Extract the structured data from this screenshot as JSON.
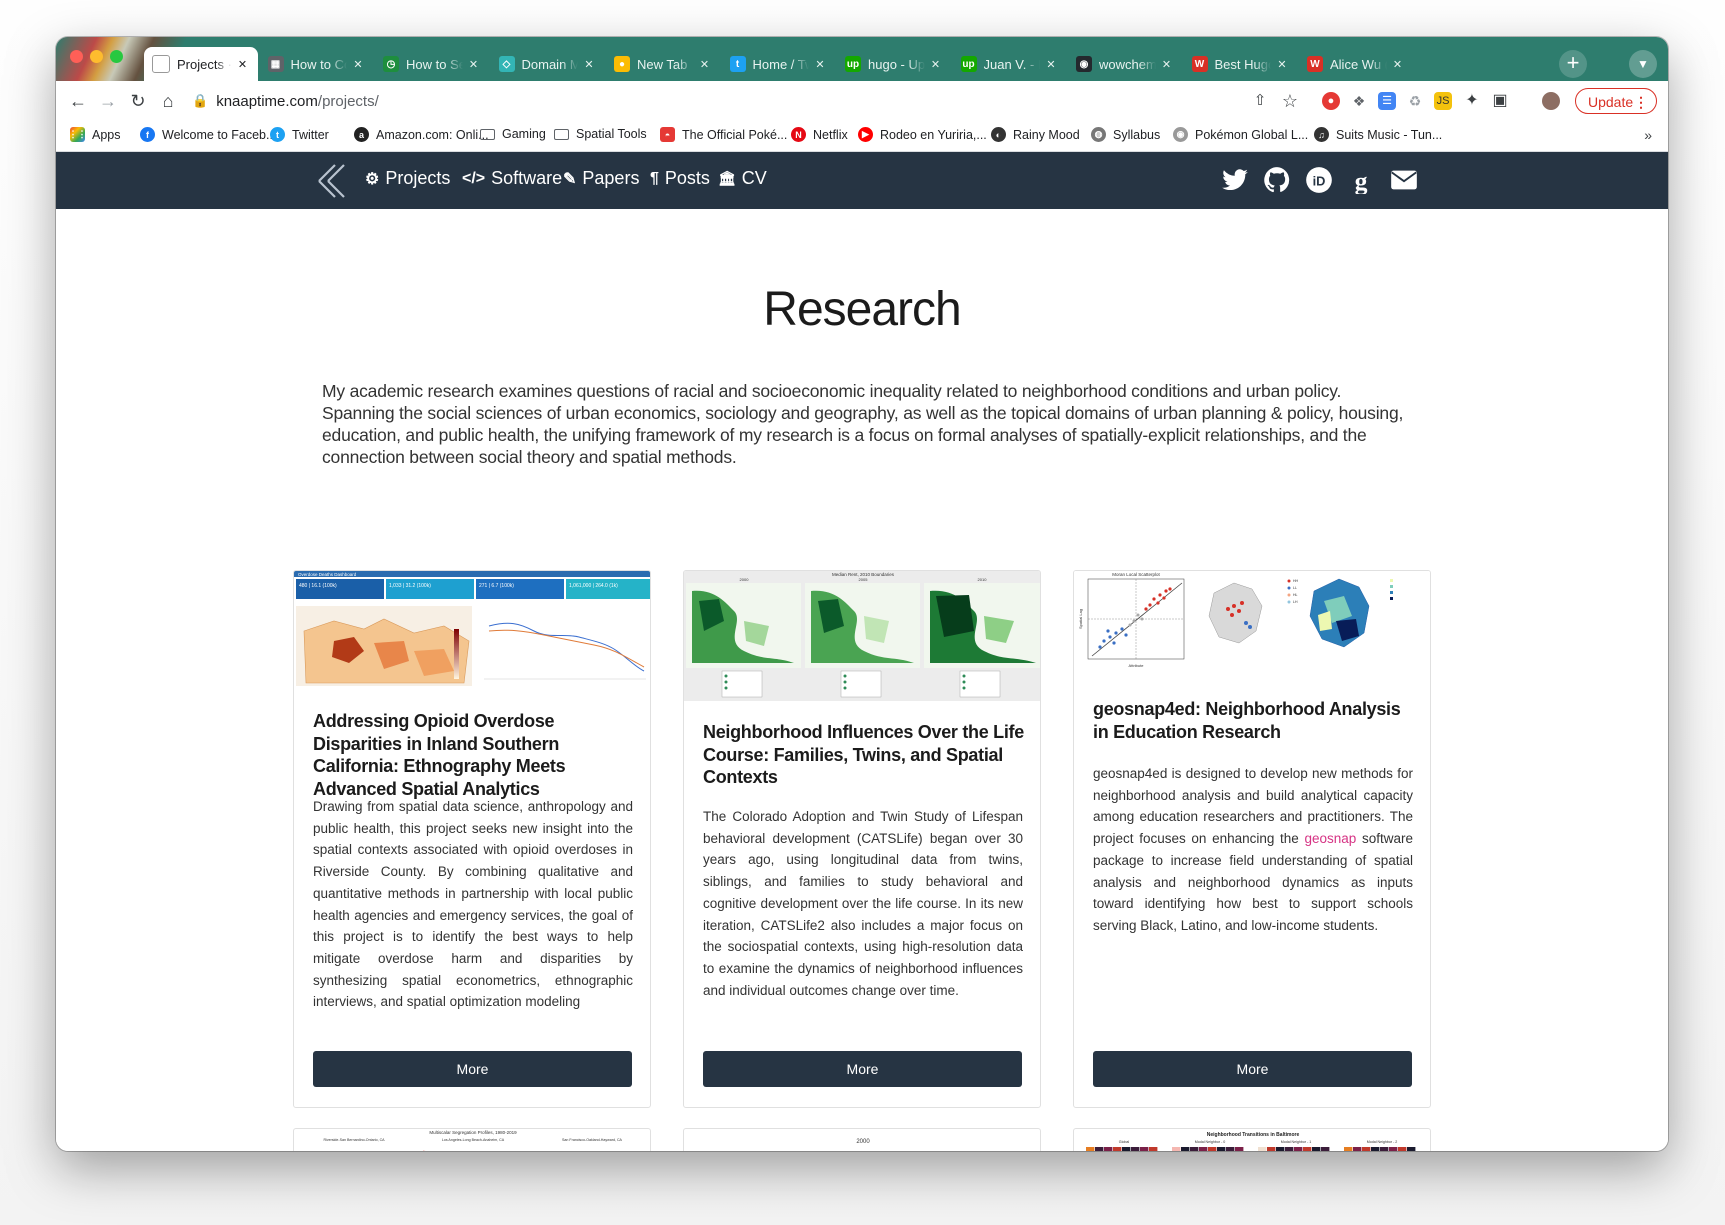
{
  "browser": {
    "tabs": [
      {
        "title": "Projects · k",
        "favicon": "page-icon",
        "active": true
      },
      {
        "title": "How to Cor",
        "favicon": "calendar-icon"
      },
      {
        "title": "How to Set",
        "favicon": "clock-icon"
      },
      {
        "title": "Domain Ma",
        "favicon": "netlify-icon"
      },
      {
        "title": "New Tab",
        "favicon": "chrome-icon"
      },
      {
        "title": "Home / Twi",
        "favicon": "twitter-icon"
      },
      {
        "title": "hugo - Upv",
        "favicon": "upwork-icon"
      },
      {
        "title": "Juan V. - F",
        "favicon": "upwork-icon"
      },
      {
        "title": "wowchemy",
        "favicon": "github-icon"
      },
      {
        "title": "Best Hugo",
        "favicon": "w-icon"
      },
      {
        "title": "Alice Wu (l",
        "favicon": "w-icon"
      }
    ],
    "new_tab": "+",
    "url_host": "knaaptime.com",
    "url_path": "/projects/",
    "update_label": "Update",
    "bookmarks": [
      {
        "label": "Apps",
        "icon": "apps-icon"
      },
      {
        "label": "Welcome to Faceb...",
        "icon": "facebook-icon"
      },
      {
        "label": "Twitter",
        "icon": "twitter-icon"
      },
      {
        "label": "Amazon.com: Onli...",
        "icon": "amazon-icon"
      },
      {
        "label": "Gaming",
        "icon": "folder-icon"
      },
      {
        "label": "Spatial Tools",
        "icon": "folder-icon"
      },
      {
        "label": "The Official Poké...",
        "icon": "pokeball-icon"
      },
      {
        "label": "Netflix",
        "icon": "netflix-icon"
      },
      {
        "label": "Rodeo en Yuriria,...",
        "icon": "youtube-icon"
      },
      {
        "label": "Rainy Mood",
        "icon": "rainy-icon"
      },
      {
        "label": "Syllabus",
        "icon": "globe-icon"
      },
      {
        "label": "Pokémon Global L...",
        "icon": "pokemon-icon"
      },
      {
        "label": "Suits Music - Tun...",
        "icon": "music-icon"
      }
    ],
    "bookmarks_more": "»"
  },
  "site": {
    "nav": [
      {
        "label": "Projects",
        "icon": "cogs-icon"
      },
      {
        "label": "Software",
        "icon": "code-icon"
      },
      {
        "label": "Papers",
        "icon": "edit-icon"
      },
      {
        "label": "Posts",
        "icon": "paragraph-icon"
      },
      {
        "label": "CV",
        "icon": "institution-icon"
      }
    ],
    "social": [
      "twitter-icon",
      "github-icon",
      "orcid-icon",
      "google-scholar-icon",
      "envelope-icon"
    ],
    "accent": "#263443"
  },
  "main": {
    "title": "Research",
    "intro": "My academic research examines questions of racial and socioeconomic inequality related to neighborhood conditions and urban policy. Spanning the social sciences of urban economics, sociology and geography, as well as the topical domains of urban planning & policy, housing, education, and public health, the unifying framework of my research is a focus on formal analyses of spatially-explicit relationships, and the connection between social theory and spatial methods.",
    "cards": [
      {
        "title": "Addressing Opioid Overdose Disparities in Inland Southern California: Ethnography Meets Advanced Spatial Analytics",
        "summary": "Drawing from spatial data science, anthropology and public health, this project seeks new insight into the spatial contexts associated with opioid overdoses in Riverside County. By combining qualitative and quantitative methods in partnership with local public health agencies and emergency services, the goal of this project is to identify the best ways to help mitigate overdose harm and disparities by synthesizing spatial econometrics, ethnographic interviews, and spatial optimization modeling",
        "button": "More"
      },
      {
        "title": "Neighborhood Influences Over the Life Course: Families, Twins, and Spatial Contexts",
        "summary": "The Colorado Adoption and Twin Study of Lifespan behavioral development (CATSLife) began over 30 years ago, using longitudinal data from twins, siblings, and families to study behavioral and cognitive development over the life course. In its new iteration, CATSLife2 also includes a major focus on the sociospatial contexts, using high-resolution data to examine the dynamics of neighborhood influences and individual outcomes change over time.",
        "button": "More"
      },
      {
        "title": "geosnap4ed: Neighborhood Analysis in Education Research",
        "summary_pre": "geosnap4ed is designed to develop new methods for neighborhood analysis and build analytical capacity among education researchers and practitioners. The project focuses on enhancing the ",
        "summary_link": "geosnap",
        "summary_post": " software package to increase field understanding of spatial analysis and neighborhood dynamics as inputs toward identifying how best to support schools serving Black, Latino, and low-income students.",
        "button": "More"
      }
    ],
    "thumb_text": {
      "card1_header": "Overdose Deaths Dashboard",
      "card1_kpis": [
        "480 | 16.1 (100k)",
        "1,033 | 31.2 (100k)",
        "271 | 6.7 (100k)",
        "1,061,000 | 264.0 (1k)"
      ],
      "card2_title": "Median Rent, 2010 Boundaries",
      "card2_years": [
        "2000",
        "2005",
        "2010"
      ],
      "card3_title": "Moran Local Scatterplot",
      "card3_xlabel": "Attribute",
      "card3_ylabel": "Spatial Lag",
      "card4_title": "Multiscalar Segregation Profiles, 1980-2019",
      "card4_panels": [
        "Riverside-San Bernardino-Ontario, CA",
        "Los Angeles-Long Beach-Anaheim, CA",
        "San Francisco-Oakland-Hayward, CA"
      ],
      "card5_year": "2000",
      "card6_title": "Neighborhood Transitions in Baltimore",
      "card6_panels": [
        "Global",
        "Modal Neighbor - 0",
        "Modal Neighbor - 1",
        "Modal Neighbor - 2"
      ]
    }
  }
}
